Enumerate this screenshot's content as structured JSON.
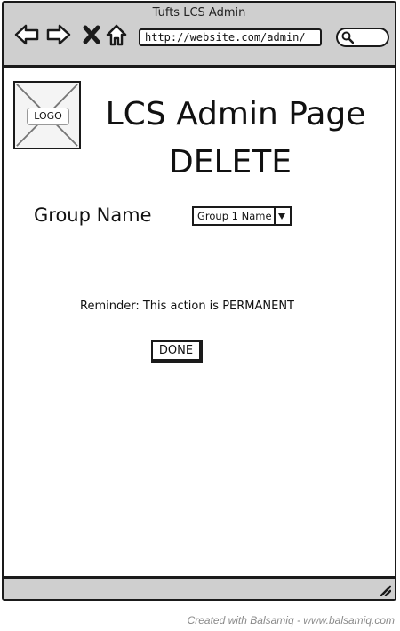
{
  "window": {
    "title": "Tufts LCS Admin",
    "url": "http://website.com/admin/"
  },
  "nav_icons": [
    "back-arrow-icon",
    "forward-arrow-icon",
    "close-icon",
    "home-icon",
    "search-icon"
  ],
  "logo": {
    "label": "LOGO"
  },
  "header": {
    "title": "LCS Admin Page",
    "subtitle": "DELETE"
  },
  "form": {
    "group_label": "Group Name",
    "group_select_value": "Group 1 Name"
  },
  "reminder_text": "Reminder: This action is PERMANENT",
  "done_label": "DONE",
  "footer_credit": "Created with Balsamiq - www.balsamiq.com",
  "colors": {
    "chrome": "#cfcfcf",
    "border": "#1a1a1a",
    "credit_text": "#8a8a8a"
  }
}
